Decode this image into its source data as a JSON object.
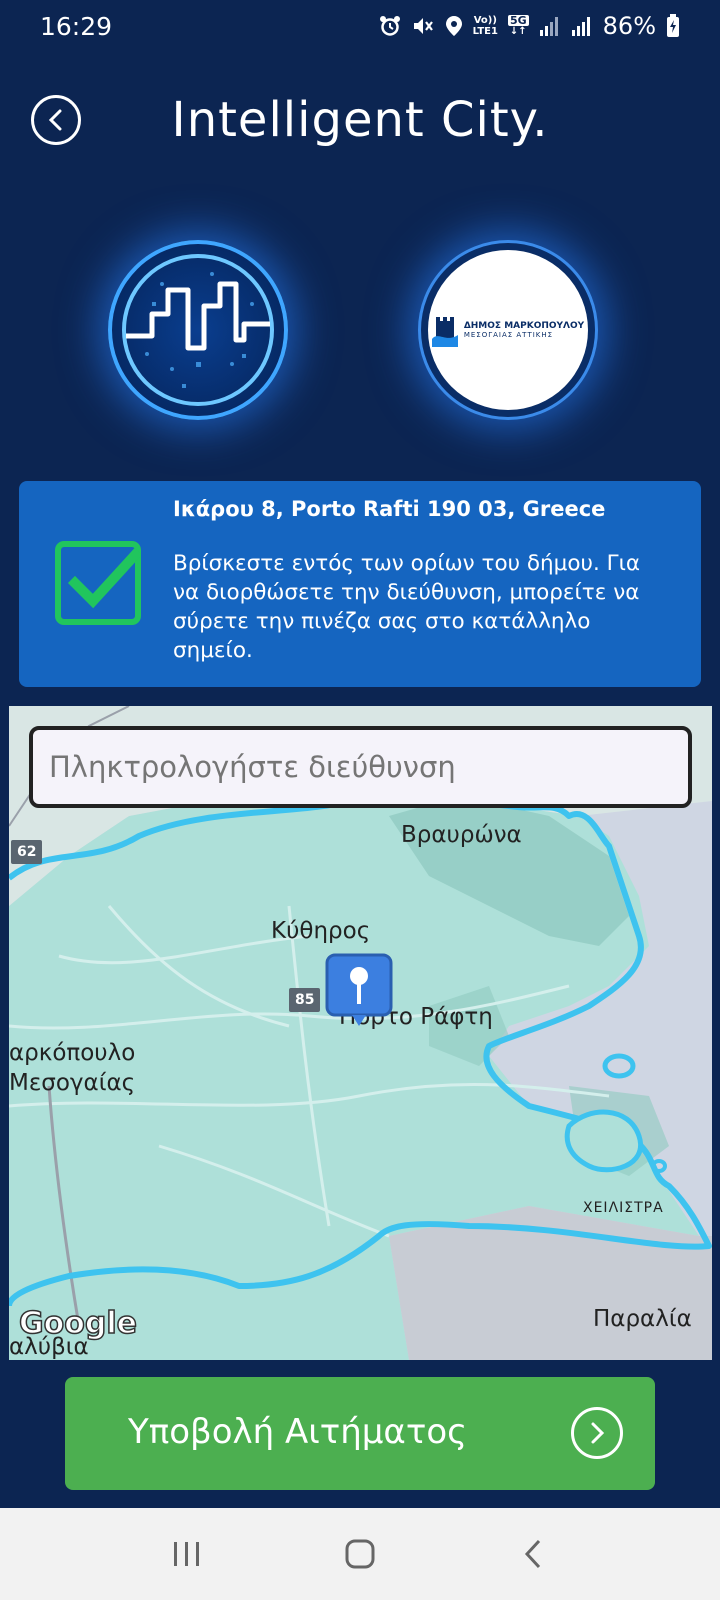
{
  "status_bar": {
    "time": "16:29",
    "network_label_top": "Vo))",
    "network_label_bottom": "LTE1",
    "network_type": "5G",
    "battery": "86%"
  },
  "header": {
    "title": "Intelligent City",
    "title_dot": "."
  },
  "logos": {
    "municipality_name": "ΔΗΜΟΣ ΜΑΡΚΟΠΟΥΛΟΥ",
    "municipality_region": "ΜΕΣΟΓΑΙΑΣ ΑΤΤΙΚΗΣ"
  },
  "info_card": {
    "address": "Ικάρου 8, Porto Rafti 190 03, Greece",
    "message": "Βρίσκεστε εντός των ορίων του δήμου. Για να διορθώσετε την διεύθυνση, μπορείτε να σύρετε την πινέζα σας στο κατάλληλο σημείο."
  },
  "map": {
    "search_placeholder": "Πληκτρολογήστε διεύθυνση",
    "labels": {
      "vravrona": "Βραυρώνα",
      "kythiros": "Κύθηρος",
      "porto_rafti": "Πόρτο Ράφτη",
      "markopoulo_1": "αρκόπουλο",
      "markopoulo_2": "Μεσογαίας",
      "cheilistra": "ΧΕΙΛΙΣΤΡΑ",
      "paralia": "Παραλία",
      "kalyvia": "αλύβια"
    },
    "road_badges": {
      "road_62": "62",
      "road_85": "85"
    },
    "attribution": "Google"
  },
  "submit": {
    "label": "Υποβολή Αιτήματος"
  },
  "colors": {
    "background": "#0c2552",
    "card": "#1565c0",
    "check": "#21c55d",
    "submit": "#4caf50",
    "boundary": "#3ec3ef"
  }
}
